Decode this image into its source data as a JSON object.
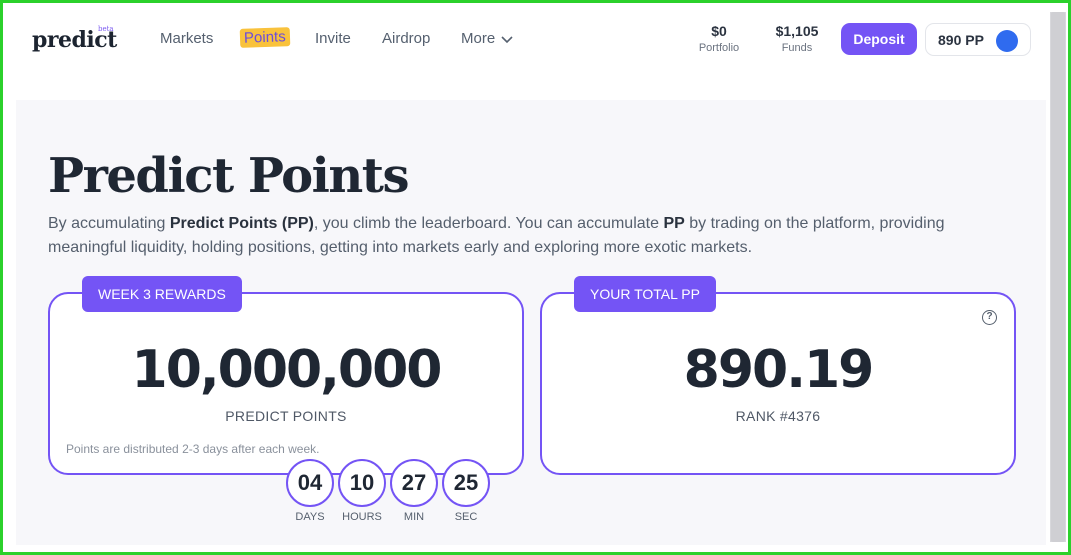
{
  "header": {
    "logo": "predict",
    "logo_badge": "beta",
    "nav": [
      {
        "label": "Markets"
      },
      {
        "label": "Points",
        "active": true
      },
      {
        "label": "Invite"
      },
      {
        "label": "Airdrop"
      },
      {
        "label": "More"
      }
    ],
    "portfolio": {
      "value": "$0",
      "label": "Portfolio"
    },
    "funds": {
      "value": "$1,105",
      "label": "Funds"
    },
    "deposit_label": "Deposit",
    "points_pill": "890 PP"
  },
  "page": {
    "title": "Predict Points",
    "intro": {
      "p1": "By accumulating ",
      "b1": "Predict Points (PP)",
      "p2": ", you climb the leaderboard. You can accumulate ",
      "b2": "PP",
      "p3": " by trading on the platform, providing meaningful liquidity, holding positions, getting into markets early and exploring more exotic markets."
    }
  },
  "rewards_card": {
    "tab": "WEEK 3 REWARDS",
    "value": "10,000,000",
    "unit": "PREDICT POINTS",
    "note": "Points are distributed 2-3 days after each week."
  },
  "total_card": {
    "tab": "YOUR TOTAL PP",
    "value": "890.19",
    "rank": "RANK #4376",
    "help_icon": "?"
  },
  "countdown": [
    {
      "value": "04",
      "label": "DAYS"
    },
    {
      "value": "10",
      "label": "HOURS"
    },
    {
      "value": "27",
      "label": "MIN"
    },
    {
      "value": "25",
      "label": "SEC"
    }
  ],
  "colors": {
    "accent": "#7454f5",
    "highlight": "#f9c23c",
    "avatar": "#2f6bef"
  }
}
